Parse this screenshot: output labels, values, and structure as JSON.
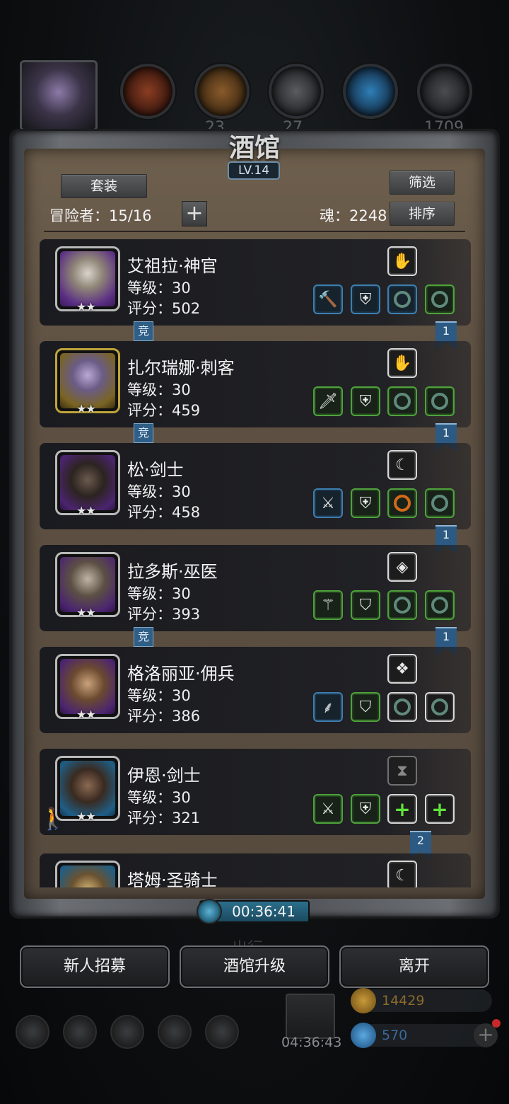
{
  "top_bar": {
    "faded_values": [
      "23",
      "27",
      "1709"
    ]
  },
  "tavern": {
    "title": "酒馆",
    "level": "LV.14",
    "set_button": "套装",
    "filter_button": "筛选",
    "sort_button": "排序",
    "adventurers_label": "冒险者：15/16",
    "soul_label": "魂：2248",
    "add_symbol": "+"
  },
  "heroes": [
    {
      "name": "艾祖拉·神官",
      "level": "等级：30",
      "score": "评分：502",
      "stars": "★★",
      "frame": "purple",
      "top_icon": "glove-icon",
      "top_tier": "white",
      "slots": [
        {
          "icon": "hammer-icon",
          "tier": "blue"
        },
        {
          "icon": "armor-icon",
          "tier": "blue"
        },
        {
          "icon": "ring-icon",
          "tier": "blue"
        },
        {
          "icon": "ring-icon",
          "tier": "green"
        }
      ],
      "tag": "竞",
      "bookmark": "1"
    },
    {
      "name": "扎尔瑞娜·刺客",
      "level": "等级：30",
      "score": "评分：459",
      "stars": "★★",
      "frame": "gold",
      "top_icon": "glove-icon",
      "top_tier": "white",
      "slots": [
        {
          "icon": "dagger-icon",
          "tier": "green"
        },
        {
          "icon": "armor-icon",
          "tier": "green"
        },
        {
          "icon": "ring-icon",
          "tier": "green"
        },
        {
          "icon": "ring-icon",
          "tier": "green"
        }
      ],
      "tag": "竞",
      "bookmark": "1"
    },
    {
      "name": "松·剑士",
      "level": "等级：30",
      "score": "评分：458",
      "stars": "★★",
      "frame": "purple",
      "top_icon": "claw-icon",
      "top_tier": "white",
      "slots": [
        {
          "icon": "sword-icon",
          "tier": "blue"
        },
        {
          "icon": "armor-icon",
          "tier": "green"
        },
        {
          "icon": "fire-ring-icon",
          "tier": "green"
        },
        {
          "icon": "ring-icon",
          "tier": "green"
        }
      ],
      "tag": "",
      "bookmark": "1"
    },
    {
      "name": "拉多斯·巫医",
      "level": "等级：30",
      "score": "评分：393",
      "stars": "★★",
      "frame": "purple",
      "top_icon": "gem-icon",
      "top_tier": "white",
      "slots": [
        {
          "icon": "staff-icon",
          "tier": "green"
        },
        {
          "icon": "cloak-icon",
          "tier": "green"
        },
        {
          "icon": "ring-icon",
          "tier": "green"
        },
        {
          "icon": "ring-icon",
          "tier": "green"
        }
      ],
      "tag": "竞",
      "bookmark": "1"
    },
    {
      "name": "格洛丽亚·佣兵",
      "level": "等级：30",
      "score": "评分：386",
      "stars": "★★",
      "frame": "purple",
      "top_icon": "crystal-icon",
      "top_tier": "white",
      "slots": [
        {
          "icon": "scythe-icon",
          "tier": "blue"
        },
        {
          "icon": "cloak-icon",
          "tier": "green"
        },
        {
          "icon": "ring-icon",
          "tier": "white"
        },
        {
          "icon": "ring-icon",
          "tier": "white"
        }
      ],
      "tag": "",
      "bookmark": ""
    },
    {
      "name": "伊恩·剑士",
      "level": "等级：30",
      "score": "评分：321",
      "stars": "★★",
      "frame": "blue",
      "top_icon": "empty-slot-icon",
      "top_tier": "gray",
      "slots": [
        {
          "icon": "sword-icon",
          "tier": "green"
        },
        {
          "icon": "armor-icon",
          "tier": "green"
        },
        {
          "icon": "add-icon",
          "tier": "white"
        },
        {
          "icon": "add-icon",
          "tier": "white"
        }
      ],
      "tag": "",
      "bookmark": "2"
    },
    {
      "name": "塔姆·圣骑士",
      "level": "",
      "score": "",
      "stars": "",
      "frame": "blue",
      "top_icon": "claw-icon",
      "top_tier": "white",
      "slots": [],
      "tag": "",
      "bookmark": ""
    }
  ],
  "timer": "00:36:41",
  "buttons": {
    "recruit": "新人招募",
    "upgrade": "酒馆升级",
    "leave": "离开"
  },
  "background": {
    "faded_label": "出行",
    "gift_timer": "04:36:43",
    "gold": "14429",
    "gems": "570"
  },
  "colors": {
    "blue_tier": "#3d7fb0",
    "green_tier": "#4fa23c",
    "white_tier": "#d8d8d8",
    "timer": "#2b6f8c"
  }
}
